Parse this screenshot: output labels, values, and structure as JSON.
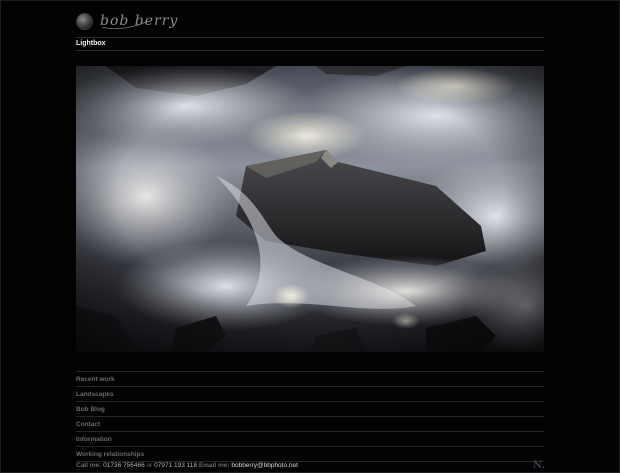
{
  "header": {
    "logo_text": "bob berry"
  },
  "page": {
    "section_title": "Lightbox"
  },
  "photo": {
    "subject": "long-exposure-water-over-rocks"
  },
  "nav": {
    "items": [
      {
        "label": "Recent work"
      },
      {
        "label": "Landscapes"
      },
      {
        "label": "Bob Blog"
      },
      {
        "label": "Contact"
      },
      {
        "label": "Information"
      },
      {
        "label": "Working relationships"
      }
    ]
  },
  "footer": {
    "call_label": "Call me:",
    "phone_1": "01736 756466",
    "or_text": "or",
    "phone_2": "07971 193 118",
    "email_label": "Email me:",
    "email": "bobberry@bbphoto.net",
    "badge_text": "N."
  },
  "colors": {
    "background": "#020202",
    "nav_text": "#6a6a6a",
    "title_text": "#f2f2f2"
  }
}
